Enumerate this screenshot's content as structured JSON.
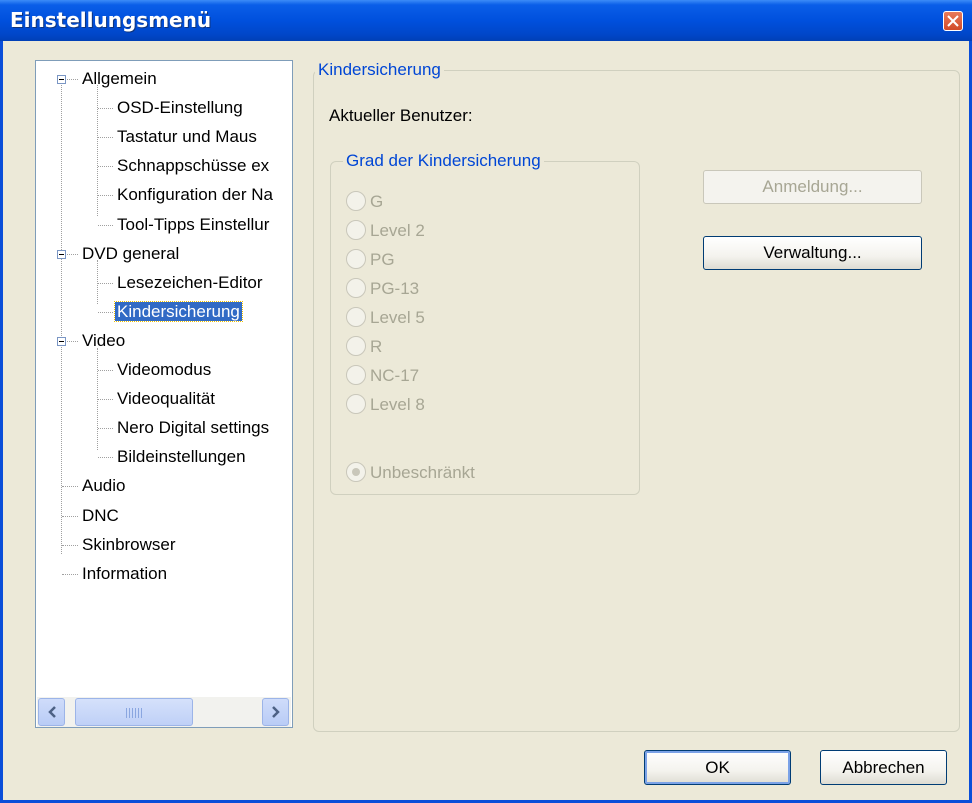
{
  "window": {
    "title": "Einstellungsmenü"
  },
  "tree": {
    "items": [
      {
        "label": "Allgemein",
        "level": 0,
        "expanded": true
      },
      {
        "label": "OSD-Einstellung",
        "level": 1
      },
      {
        "label": "Tastatur und Maus",
        "level": 1
      },
      {
        "label": "Schnappschüsse ex",
        "level": 1
      },
      {
        "label": "Konfiguration der Na",
        "level": 1
      },
      {
        "label": "Tool-Tipps Einstellur",
        "level": 1
      },
      {
        "label": "DVD general",
        "level": 0,
        "expanded": true
      },
      {
        "label": "Lesezeichen-Editor",
        "level": 1
      },
      {
        "label": "Kindersicherung",
        "level": 1,
        "selected": true
      },
      {
        "label": "Video",
        "level": 0,
        "expanded": true
      },
      {
        "label": "Videomodus",
        "level": 1
      },
      {
        "label": "Videoqualität",
        "level": 1
      },
      {
        "label": "Nero Digital settings",
        "level": 1
      },
      {
        "label": "Bildeinstellungen",
        "level": 1
      },
      {
        "label": "Audio",
        "level": 0
      },
      {
        "label": "DNC",
        "level": 0
      },
      {
        "label": "Skinbrowser",
        "level": 0
      },
      {
        "label": "Information",
        "level": 0
      }
    ],
    "scrollbar_grip": "III"
  },
  "panel": {
    "group_title": "Kindersicherung",
    "current_user_label": "Aktueller Benutzer:",
    "rating_group_title": "Grad der Kindersicherung",
    "ratings": [
      {
        "label": "G",
        "checked": false
      },
      {
        "label": "Level 2",
        "checked": false
      },
      {
        "label": "PG",
        "checked": false
      },
      {
        "label": "PG-13",
        "checked": false
      },
      {
        "label": "Level 5",
        "checked": false
      },
      {
        "label": "R",
        "checked": false
      },
      {
        "label": "NC-17",
        "checked": false
      },
      {
        "label": "Level 8",
        "checked": false
      },
      {
        "label": "Unbeschränkt",
        "checked": true
      }
    ],
    "login_button": "Anmeldung...",
    "manage_button": "Verwaltung..."
  },
  "footer": {
    "ok": "OK",
    "cancel": "Abbrechen"
  },
  "colors": {
    "title_bar": "#0050dd",
    "group_title": "#0046d5",
    "selection": "#316ac5",
    "disabled_text": "#a7a694"
  },
  "icons": {
    "close": "close-icon",
    "expander": "minus-box-icon",
    "scroll_left": "arrow-left-icon",
    "scroll_right": "arrow-right-icon"
  }
}
